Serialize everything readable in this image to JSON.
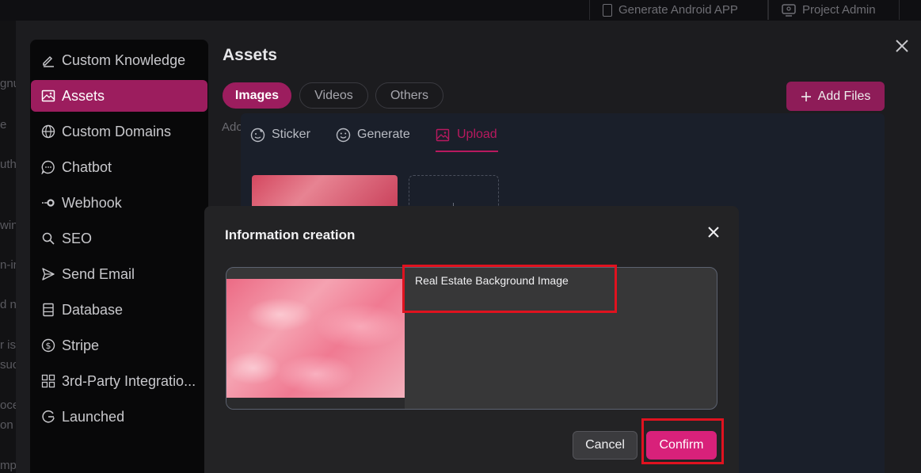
{
  "topbar": {
    "android_label": "Generate Android APP",
    "admin_label": "Project Admin"
  },
  "background_fragments": [
    "gnu",
    "e",
    "uth",
    "win",
    "n-in",
    "d n",
    "r is",
    "suc",
    "oce",
    "on",
    "mpl"
  ],
  "sidebar": {
    "items": [
      {
        "label": "Custom Knowledge",
        "icon": "pencil-icon"
      },
      {
        "label": "Assets",
        "icon": "image-icon"
      },
      {
        "label": "Custom Domains",
        "icon": "globe-icon"
      },
      {
        "label": "Chatbot",
        "icon": "chat-bubble-icon"
      },
      {
        "label": "Webhook",
        "icon": "webhook-icon"
      },
      {
        "label": "SEO",
        "icon": "search-icon"
      },
      {
        "label": "Send Email",
        "icon": "send-icon"
      },
      {
        "label": "Database",
        "icon": "database-icon"
      },
      {
        "label": "Stripe",
        "icon": "dollar-icon"
      },
      {
        "label": "3rd-Party Integratio...",
        "icon": "grid-icon"
      },
      {
        "label": "Launched",
        "icon": "launch-icon"
      }
    ],
    "active_index": 1
  },
  "assets": {
    "title": "Assets",
    "tabs": [
      {
        "label": "Images",
        "active": true
      },
      {
        "label": "Videos",
        "active": false
      },
      {
        "label": "Others",
        "active": false
      }
    ],
    "add_files_label": "Add Files",
    "fragment": "Ado"
  },
  "upload_panel": {
    "tabs": [
      {
        "label": "Sticker",
        "icon": "sticker-icon",
        "active": false
      },
      {
        "label": "Generate",
        "icon": "smile-icon",
        "active": false
      },
      {
        "label": "Upload",
        "icon": "upload-image-icon",
        "active": true
      }
    ]
  },
  "dialog": {
    "title": "Information creation",
    "description_value": "Real Estate Background Image",
    "cancel_label": "Cancel",
    "confirm_label": "Confirm"
  },
  "colors": {
    "accent": "#9c1d5e",
    "confirm": "#d8217a",
    "highlight": "#e0121f",
    "upload_active": "#b8195f"
  }
}
